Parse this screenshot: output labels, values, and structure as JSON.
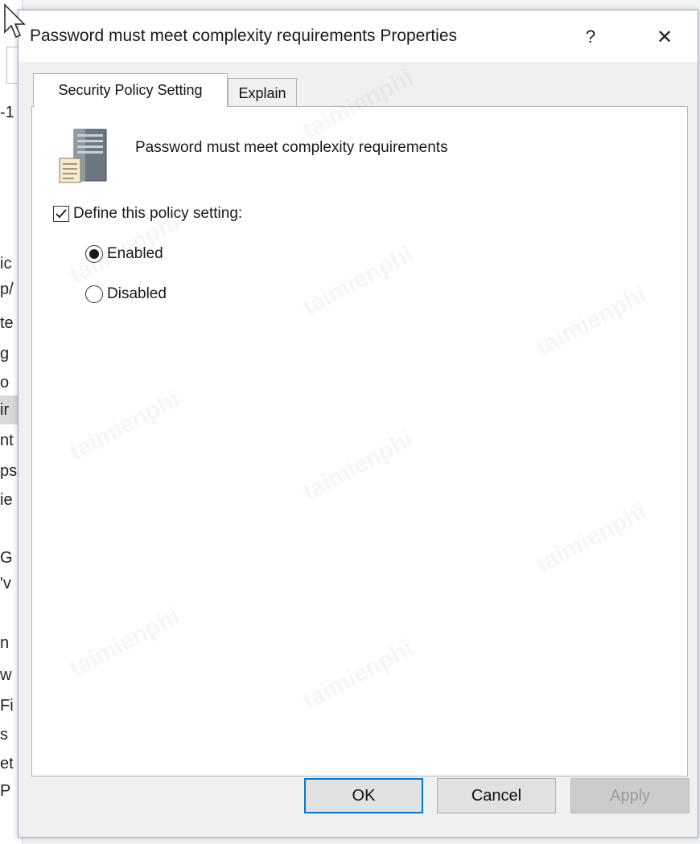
{
  "background_fragments": [
    "-1",
    "ic",
    "p/",
    "te",
    "g",
    "o",
    "ir",
    "nt",
    "ps",
    "ie",
    "G",
    "'v",
    "n",
    "w",
    "Fi",
    "s",
    "et",
    "P"
  ],
  "dialog": {
    "title": "Password must meet complexity requirements Properties",
    "help_label": "?",
    "close_label": "✕"
  },
  "tabs": [
    {
      "label": "Security Policy Setting",
      "selected": true
    },
    {
      "label": "Explain",
      "selected": false
    }
  ],
  "policy": {
    "icon": "server-policy-icon",
    "name": "Password must meet complexity requirements"
  },
  "define_setting": {
    "label": "Define this policy setting:",
    "checked": true
  },
  "options": [
    {
      "label": "Enabled",
      "selected": true
    },
    {
      "label": "Disabled",
      "selected": false
    }
  ],
  "buttons": {
    "ok": "OK",
    "cancel": "Cancel",
    "apply": "Apply"
  },
  "colors": {
    "default_button_border": "#0078d7",
    "window_border": "#8fb4d8"
  }
}
